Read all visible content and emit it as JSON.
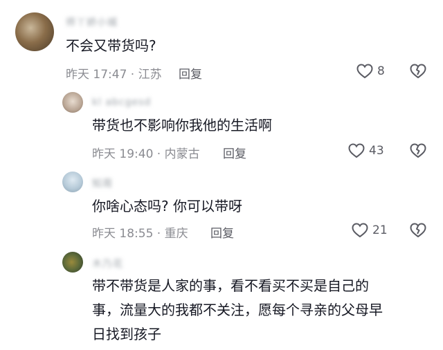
{
  "comments": [
    {
      "username": "师丫娇小城",
      "text": "不会又带货吗?",
      "meta": "昨天 17:47 · 江苏",
      "reply_label": "回复",
      "likes": "8"
    },
    {
      "username": "kl abcgesd",
      "text": "带货也不影响你我他的生活啊",
      "meta": "昨天 19:40 · 内蒙古",
      "reply_label": "回复",
      "likes": "43"
    },
    {
      "username": "知周",
      "text": "你啥心态吗? 你可以带呀",
      "meta": "昨天 18:55 · 重庆",
      "reply_label": "回复",
      "likes": "21"
    },
    {
      "username": "木乃花",
      "text_lines": [
        "带不带货是人家的事，看不看买不买是自己的",
        "事，流量大的我都不关注，愿每个寻亲的父母早",
        "日找到孩子"
      ]
    }
  ],
  "icons": {
    "like": "heart-outline-icon",
    "dislike": "broken-heart-icon"
  }
}
